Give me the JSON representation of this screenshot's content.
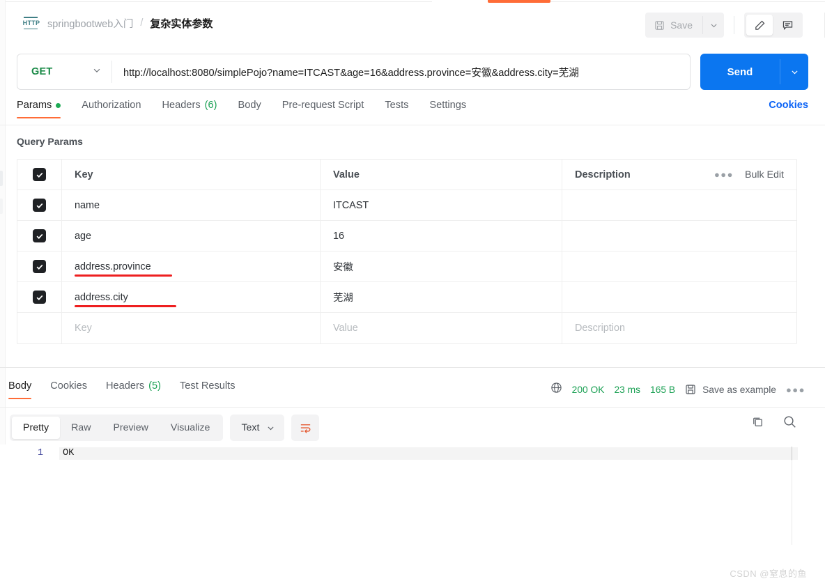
{
  "window": {
    "accent_orange": "#ff6c37",
    "accent_blue": "#0b76f0",
    "accent_green": "#1aa053"
  },
  "header": {
    "protocol_badge": "HTTP",
    "collection": "springbootweb入门",
    "separator": "/",
    "request_name": "复杂实体参数",
    "save_label": "Save",
    "save_caret": "chevron-down-icon",
    "edit_icon": "pencil-icon",
    "comment_icon": "comment-icon"
  },
  "url_bar": {
    "method": "GET",
    "method_caret": "chevron-down-icon",
    "url": "http://localhost:8080/simplePojo?name=ITCAST&age=16&address.province=安徽&address.city=芜湖",
    "send_label": "Send",
    "send_caret": "chevron-down-icon"
  },
  "request_tabs": {
    "items": [
      {
        "label": "Params",
        "badge": "dot",
        "active": true
      },
      {
        "label": "Authorization",
        "badge": "",
        "active": false
      },
      {
        "label": "Headers",
        "badge": "(6)",
        "active": false
      },
      {
        "label": "Body",
        "badge": "",
        "active": false
      },
      {
        "label": "Pre-request Script",
        "badge": "",
        "active": false
      },
      {
        "label": "Tests",
        "badge": "",
        "active": false
      },
      {
        "label": "Settings",
        "badge": "",
        "active": false
      }
    ],
    "cookies_link": "Cookies"
  },
  "query_params": {
    "section_title": "Query Params",
    "bulk_edit_label": "Bulk Edit",
    "more_icon": "ellipsis-icon",
    "columns": {
      "key": "Key",
      "value": "Value",
      "description": "Description"
    },
    "rows": [
      {
        "checked": true,
        "key": "name",
        "value": "ITCAST",
        "description": "",
        "annotated": false
      },
      {
        "checked": true,
        "key": "age",
        "value": "16",
        "description": "",
        "annotated": false
      },
      {
        "checked": true,
        "key": "address.province",
        "value": "安徽",
        "description": "",
        "annotated": true
      },
      {
        "checked": true,
        "key": "address.city",
        "value": "芜湖",
        "description": "",
        "annotated": true
      }
    ],
    "placeholder_row": {
      "key": "Key",
      "value": "Value",
      "description": "Description"
    }
  },
  "response": {
    "tabs": [
      {
        "label": "Body",
        "badge": "",
        "active": true
      },
      {
        "label": "Cookies",
        "badge": "",
        "active": false
      },
      {
        "label": "Headers",
        "badge": "(5)",
        "active": false
      },
      {
        "label": "Test Results",
        "badge": "",
        "active": false
      }
    ],
    "globe_icon": "globe-icon",
    "status": "200 OK",
    "time": "23 ms",
    "size": "165 B",
    "save_icon": "floppy-disk-icon",
    "save_as_example": "Save as example",
    "more_icon": "ellipsis-icon",
    "view_modes": [
      {
        "label": "Pretty",
        "active": true
      },
      {
        "label": "Raw",
        "active": false
      },
      {
        "label": "Preview",
        "active": false
      },
      {
        "label": "Visualize",
        "active": false
      }
    ],
    "format": "Text",
    "format_caret": "chevron-down-icon",
    "wrap_icon": "word-wrap-icon",
    "copy_icon": "copy-icon",
    "search_icon": "search-icon",
    "body_lines": [
      {
        "number": "1",
        "text": "OK"
      }
    ]
  },
  "watermark": "CSDN @窒息的鱼"
}
